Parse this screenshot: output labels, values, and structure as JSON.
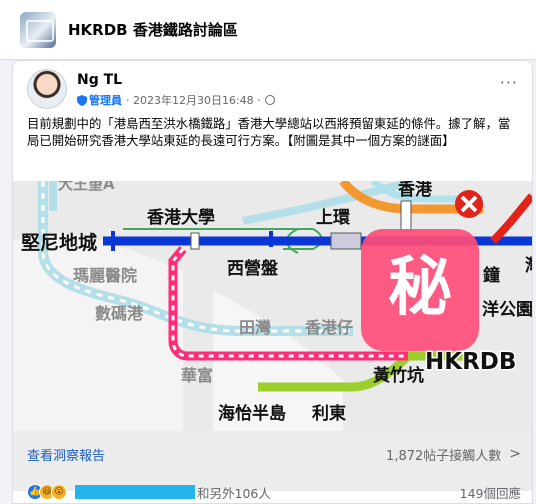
{
  "group": {
    "name": "HKRDB 香港鐵路討論區"
  },
  "post": {
    "author": "Ng TL",
    "role_badge": "管理員",
    "timestamp": "· 2023年12月30日16:48 ·",
    "more": "···",
    "text": "目前規劃中的「港島西至洪水橋鐵路」香港大學總站以西將預留東延的條件。據了解，當局已開始研究香港大學站東延的長遠可行方案。【附圖是其中一個方案的謎面】"
  },
  "map": {
    "stations": {
      "hkrdb_top": "大王望A",
      "hongkong": "香港",
      "hku": "香港大學",
      "sheung_wan": "上環",
      "kennedy_town": "堅尼地城",
      "sai_ying_pun": "西營盤",
      "queen_mary": "瑪麗醫院",
      "cyberport": "數碼港",
      "tin_wan": "田灣",
      "hk_tsai": "香港仔",
      "wah_fu": "華富",
      "wong_chuk_hang": "黃竹坑",
      "ocean_park": "洋公園",
      "admiralty_partial": "鐘",
      "wan_chai_partial": "灣",
      "south_horizons": "海怡半島",
      "lei_tung": "利東"
    },
    "secret_badge": "秘",
    "watermark": "HKRDB",
    "colors": {
      "island_line": "#0a36d8",
      "tung_chung": "#f3982e",
      "south_island": "#9ccf2c",
      "new_line": "#ff2d77",
      "badge": "#ff4d7a",
      "closed": "#e2231a"
    }
  },
  "footer": {
    "insights": "查看洞察報告",
    "reach": "1,872帖子接觸人數",
    "reactions_text": "和另外106人",
    "comments": "149個回應"
  }
}
